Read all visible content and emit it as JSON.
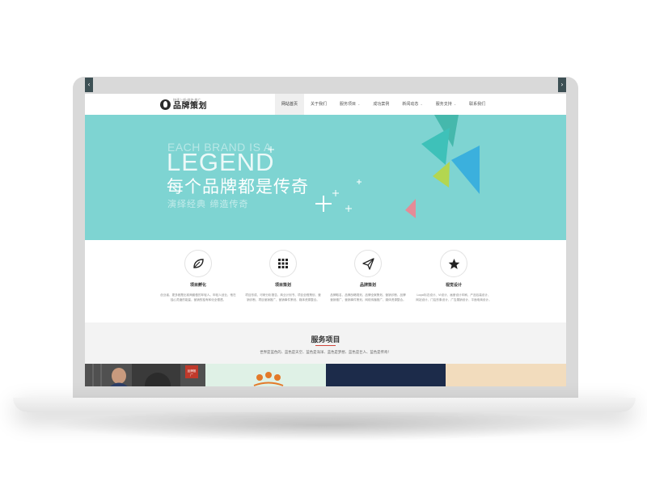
{
  "colors": {
    "hero_bg": "#7ed4d2",
    "accent_red": "#d0463c",
    "nav_active_bg": "#efefef",
    "arrow_bg": "#3d5054"
  },
  "logo": {
    "tagline": "快速上线·维护·推广",
    "name": "品牌策划"
  },
  "nav": {
    "items": [
      {
        "label": "网站首页",
        "active": true,
        "dropdown": false
      },
      {
        "label": "关于我们",
        "active": false,
        "dropdown": false
      },
      {
        "label": "服务项目",
        "active": false,
        "dropdown": true
      },
      {
        "label": "成功案例",
        "active": false,
        "dropdown": false
      },
      {
        "label": "新闻动态",
        "active": false,
        "dropdown": true
      },
      {
        "label": "服务支持",
        "active": false,
        "dropdown": true
      },
      {
        "label": "联系我们",
        "active": false,
        "dropdown": false
      }
    ],
    "caret": "⌄"
  },
  "hero": {
    "en_line1": "EACH BRAND IS A",
    "en_line2": "LEGEND",
    "cn_title": "每个品牌都是传奇",
    "cn_sub": "演绎经典  缔造传奇",
    "prev_icon": "chevron-left-icon",
    "next_icon": "chevron-right-icon",
    "prev_glyph": "‹",
    "next_glyph": "›"
  },
  "services": [
    {
      "title": "项目孵化",
      "icon": "leaf-icon",
      "desc": "创业者、更多都是出前两套做的年轻人。年轻人创业，他在独心灵缩的能量，营销的独有和化全德透。"
    },
    {
      "title": "项目策划",
      "icon": "grid-icon",
      "desc": "项目形成、可研分析报告、商业计划书、项目全程策划、营销诊断、项目营销推广、营销事件策划、媒体资源整合。"
    },
    {
      "title": "品牌策划",
      "icon": "paper-plane-icon",
      "desc": "品牌取名、品牌战略规划、品牌全案策划、营销诊断、品牌营销推广、营销事件策划、网络传播推广、媒体资源整合。"
    },
    {
      "title": "视觉设计",
      "icon": "star-icon",
      "desc": "Logo标志设计、VI设计、画册设计印刷、产品包装设计、网站设计、门店形象设计、广告展销设计、平面电商设计。"
    }
  ],
  "projects": {
    "title": "服务项目",
    "desc": "世界是蓝色的、蓝色是天空、蓝色是海洋、蓝色是梦想、蓝色是巨人、蓝色是传奇！",
    "thumbs": [
      {
        "name": "project-thumb-1",
        "badge": "品牌推广"
      },
      {
        "name": "project-thumb-2"
      },
      {
        "name": "project-thumb-3"
      },
      {
        "name": "project-thumb-4"
      }
    ]
  }
}
